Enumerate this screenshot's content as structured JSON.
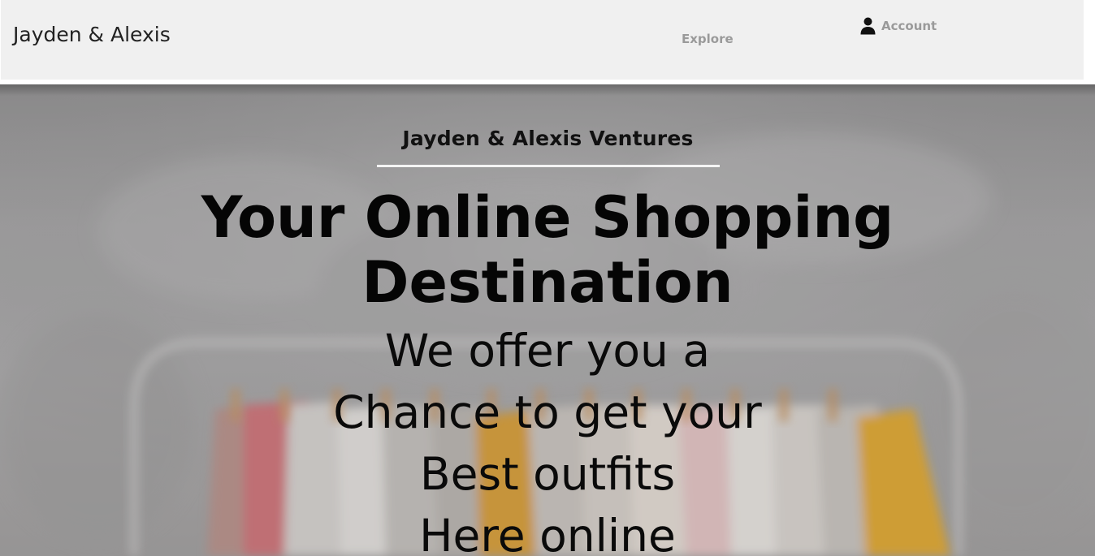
{
  "header": {
    "brand": "Jayden & Alexis",
    "nav": {
      "explore": "Explore",
      "account": "Account",
      "account_icon": "user-icon"
    }
  },
  "hero": {
    "eyebrow": "Jayden & Alexis Ventures",
    "headline": "Your Online Shopping Destination",
    "tagline_lines": [
      "We offer you a",
      "Chance to get your",
      "Best outfits",
      "Here online"
    ],
    "background_image": "clothing-rack-photo"
  },
  "colors": {
    "header_bg": "#f0f0f0",
    "nav_text": "#9a9a9a",
    "brand_text": "#222222",
    "hero_text": "#050505",
    "rule": "#f4f4f4"
  }
}
